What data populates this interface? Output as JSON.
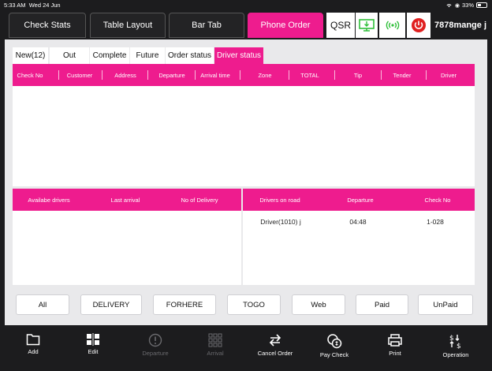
{
  "status_bar": {
    "time": "5:33 AM",
    "date": "Wed 24 Jun",
    "battery": "33%"
  },
  "top_tabs": [
    {
      "label": "Check Stats",
      "active": false
    },
    {
      "label": "Table Layout",
      "active": false
    },
    {
      "label": "Bar Tab",
      "active": false
    },
    {
      "label": "Phone Order",
      "active": true
    }
  ],
  "qsr_label": "QSR",
  "user_name": "7878mange j",
  "sub_tabs": [
    {
      "label": "New(12)",
      "active": false
    },
    {
      "label": "Out",
      "active": false
    },
    {
      "label": "Complete",
      "active": false
    },
    {
      "label": "Future",
      "active": false
    },
    {
      "label": "Order status",
      "active": false
    },
    {
      "label": "Driver status",
      "active": true
    }
  ],
  "check_table": {
    "columns": [
      "Check No",
      "Customer",
      "Address",
      "Departure",
      "Arrival time",
      "Zone",
      "TOTAL",
      "Tip",
      "Tender",
      "Driver"
    ],
    "rows": []
  },
  "available_drivers": {
    "columns": [
      "Availabe drivers",
      "Last arrival",
      "No of Delivery"
    ],
    "rows": []
  },
  "drivers_on_road": {
    "columns": [
      "Drivers on road",
      "Departure",
      "Check No"
    ],
    "rows": [
      [
        "Driver(1010) j",
        "04:48",
        "1-028"
      ]
    ]
  },
  "filters": [
    "All",
    "DELIVERY",
    "FORHERE",
    "TOGO",
    "Web",
    "Paid",
    "UnPaid"
  ],
  "toolbar": [
    {
      "label": "Add",
      "icon": "folder-icon",
      "enabled": true
    },
    {
      "label": "Edit",
      "icon": "edit-grid-icon",
      "enabled": true
    },
    {
      "label": "Departure",
      "icon": "alert-circle-icon",
      "enabled": false
    },
    {
      "label": "Arrival",
      "icon": "grid-icon",
      "enabled": false
    },
    {
      "label": "Cancel Order",
      "icon": "swap-arrows-icon",
      "enabled": true
    },
    {
      "label": "Pay Check",
      "icon": "coins-icon",
      "enabled": true
    },
    {
      "label": "Print",
      "icon": "printer-icon",
      "enabled": true
    },
    {
      "label": "Operation",
      "icon": "dollar-arrows-icon",
      "enabled": true
    }
  ],
  "colors": {
    "accent": "#ee1c8e",
    "background": "#1c1c1e",
    "panel": "#e9e9eb",
    "monitor_icon": "#2fbf3a",
    "signal_icon": "#2fbf3a",
    "power_icon": "#e02020"
  }
}
